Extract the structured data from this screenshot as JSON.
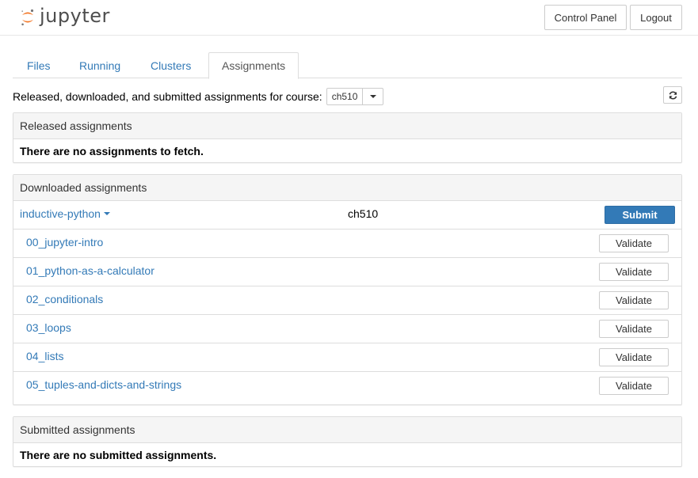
{
  "header": {
    "logo_text": "jupyter",
    "control_panel": "Control Panel",
    "logout": "Logout"
  },
  "tabs": [
    {
      "label": "Files"
    },
    {
      "label": "Running"
    },
    {
      "label": "Clusters"
    },
    {
      "label": "Assignments",
      "active": true
    }
  ],
  "course": {
    "label": "Released, downloaded, and submitted assignments for course:",
    "selected": "ch510"
  },
  "released": {
    "heading": "Released assignments",
    "message": "There are no assignments to fetch."
  },
  "downloaded": {
    "heading": "Downloaded assignments",
    "assignment": "inductive-python",
    "course": "ch510",
    "submit_label": "Submit",
    "validate_label": "Validate",
    "notebooks": [
      "00_jupyter-intro",
      "01_python-as-a-calculator",
      "02_conditionals",
      "03_loops",
      "04_lists",
      "05_tuples-and-dicts-and-strings"
    ]
  },
  "submitted": {
    "heading": "Submitted assignments",
    "message": "There are no submitted assignments."
  },
  "colors": {
    "link": "#337ab7",
    "primary_button": "#337ab7",
    "logo_orange": "#f37726"
  }
}
